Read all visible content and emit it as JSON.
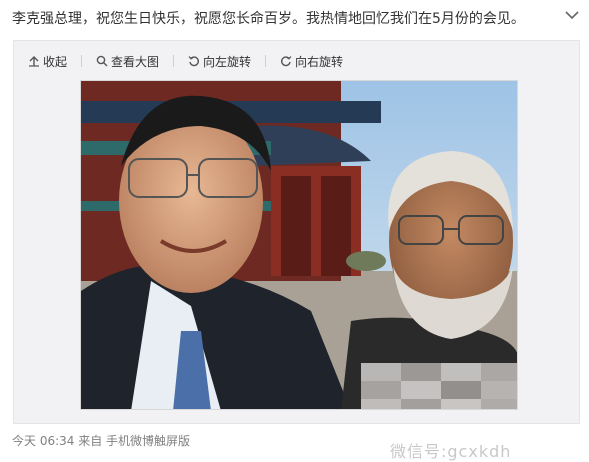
{
  "post": {
    "text": "李克强总理，祝您生日快乐，祝愿您长命百岁。我热情地回忆我们在5月份的会见。"
  },
  "toolbar": {
    "collapse_label": "收起",
    "view_large_label": "查看大图",
    "rotate_left_label": "向左旋转",
    "rotate_right_label": "向右旋转"
  },
  "meta": {
    "time": "今天 06:34",
    "source": "来自 手机微博触屏版"
  },
  "watermark": {
    "text": "微信号:gcxkdh"
  },
  "photo": {
    "description_icon": "selfie-photo"
  }
}
